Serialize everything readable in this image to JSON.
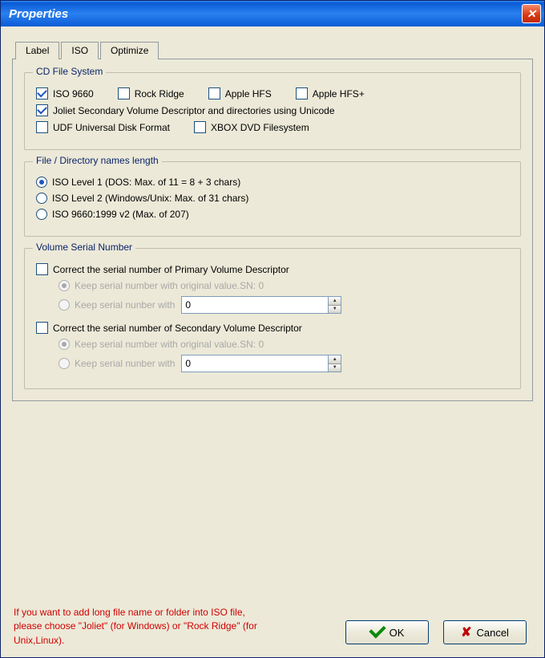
{
  "window": {
    "title": "Properties"
  },
  "tabs": {
    "label": "Label",
    "iso": "ISO",
    "optimize": "Optimize",
    "active": "ISO"
  },
  "fs": {
    "group": "CD File System",
    "iso9660": "ISO 9660",
    "rockridge": "Rock Ridge",
    "applehfs": "Apple HFS",
    "applehfsplus": "Apple HFS+",
    "joliet": "Joliet  Secondary Volume Descriptor and directories using Unicode",
    "udf": "UDF  Universal Disk Format",
    "xbox": "XBOX DVD Filesystem"
  },
  "len": {
    "group": "File / Directory names  length",
    "lvl1": "ISO Level 1 (DOS: Max. of 11 = 8 + 3 chars)",
    "lvl2": "ISO Level 2 (Windows/Unix: Max. of 31 chars)",
    "lvl3": "ISO 9660:1999 v2 (Max. of 207)"
  },
  "vsn": {
    "group": "Volume Serial Number",
    "correctPrimary": "Correct the serial number of  Primary Volume Descriptor",
    "keepOriginal": "Keep serial number with original value.SN: 0",
    "keepWith": "Keep serial nunber with",
    "spin1": "0",
    "correctSecondary": "Correct the serial number of  Secondary Volume Descriptor",
    "spin2": "0"
  },
  "hint": "If you want to add long file name or folder into ISO file, please choose \"Joliet\" (for Windows) or \"Rock Ridge\" (for Unix,Linux).",
  "buttons": {
    "ok": "OK",
    "cancel": "Cancel"
  }
}
